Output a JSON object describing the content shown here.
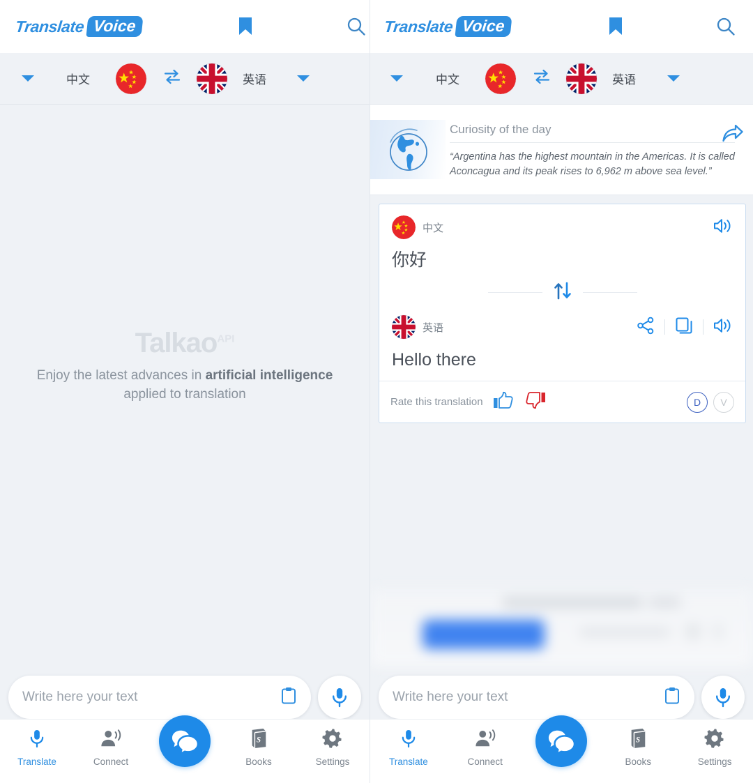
{
  "app": {
    "brand_primary": "Translate",
    "brand_secondary": "Voice",
    "accent_color": "#2f8fe0"
  },
  "header": {
    "bookmark_icon": "bookmark-icon",
    "search_icon": "search-icon"
  },
  "language_bar": {
    "source_caret": "chevron-down-icon",
    "source_label": "中文",
    "source_flag": "china-flag",
    "swap_icon": "swap-horizontal-icon",
    "target_flag": "uk-flag",
    "target_label": "英语",
    "target_caret": "chevron-down-icon"
  },
  "empty_state": {
    "brand": "Talkao",
    "brand_sup": "API",
    "line1_prefix": "Enjoy the latest advances in ",
    "line1_bold": "artificial intelligence",
    "line2": "applied to translation"
  },
  "curiosity": {
    "icon": "globe-icon",
    "title": "Curiosity of the day",
    "text": "“Argentina has the highest mountain in the Americas. It is called Aconcagua and its peak rises to 6,962 m above sea level.”",
    "share_icon": "share-arrow-icon"
  },
  "translation_card": {
    "source": {
      "flag": "china-flag",
      "lang": "中文",
      "text": "你好",
      "speaker_icon": "speaker-icon"
    },
    "swap_icon": "swap-vertical-icon",
    "target": {
      "flag": "uk-flag",
      "lang": "英语",
      "text": "Hello there",
      "share_icon": "share-nodes-icon",
      "copy_icon": "copy-icon",
      "speaker_icon": "speaker-icon"
    },
    "rate": {
      "label": "Rate this translation",
      "thumbs_up_icon": "thumbs-up-icon",
      "thumbs_down_icon": "thumbs-down-icon",
      "badge_active": "D",
      "badge_inactive": "V"
    }
  },
  "input_bar": {
    "placeholder": "Write here your text",
    "clipboard_icon": "clipboard-icon",
    "mic_icon": "microphone-icon"
  },
  "bottom_nav": {
    "items": [
      {
        "label": "Translate",
        "icon": "microphone-icon",
        "active": true
      },
      {
        "label": "Connect",
        "icon": "person-speaking-icon",
        "active": false
      },
      {
        "label": "",
        "icon": "chat-bubbles-icon",
        "active": false
      },
      {
        "label": "Books",
        "icon": "book-icon",
        "active": false
      },
      {
        "label": "Settings",
        "icon": "gear-icon",
        "active": false
      }
    ]
  }
}
